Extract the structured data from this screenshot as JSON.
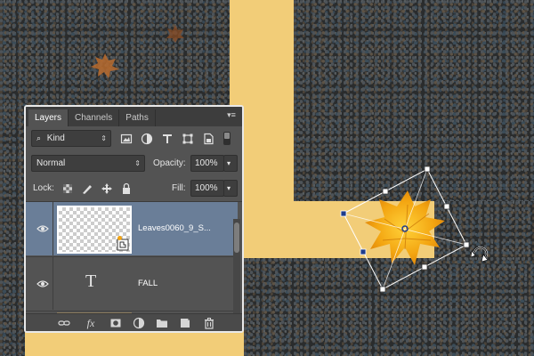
{
  "panel": {
    "tabs": [
      {
        "label": "Layers",
        "active": true
      },
      {
        "label": "Channels",
        "active": false
      },
      {
        "label": "Paths",
        "active": false
      }
    ],
    "menu_icon": "panel-menu-icon",
    "filter": {
      "kind_label": "Kind",
      "icons": [
        "pixel-filter-icon",
        "adjustment-filter-icon",
        "type-filter-icon",
        "shape-filter-icon",
        "smart-object-filter-icon"
      ]
    },
    "blend_mode": "Normal",
    "opacity_label": "Opacity:",
    "opacity_value": "100%",
    "lock_label": "Lock:",
    "lock_icons": [
      "lock-transparent-pixels-icon",
      "lock-image-pixels-icon",
      "lock-position-icon",
      "lock-all-icon"
    ],
    "fill_label": "Fill:",
    "fill_value": "100%",
    "layers": [
      {
        "name": "Leaves0060_9_S...",
        "type": "smart-object",
        "selected": true,
        "visible": true
      },
      {
        "name": "FALL",
        "type": "text",
        "selected": false,
        "visible": true,
        "thumb_glyph": "T"
      }
    ],
    "footer_icons": [
      "link-layers-icon",
      "fx-icon",
      "add-mask-icon",
      "adjustment-layer-icon",
      "new-group-icon",
      "new-layer-icon",
      "delete-layer-icon"
    ],
    "fx_label": "fx"
  },
  "colors": {
    "letter_fill": "#f2cd78",
    "panel_bg": "#535353",
    "selected_layer": "#6a7e98",
    "handle": "#1f3c8c"
  }
}
